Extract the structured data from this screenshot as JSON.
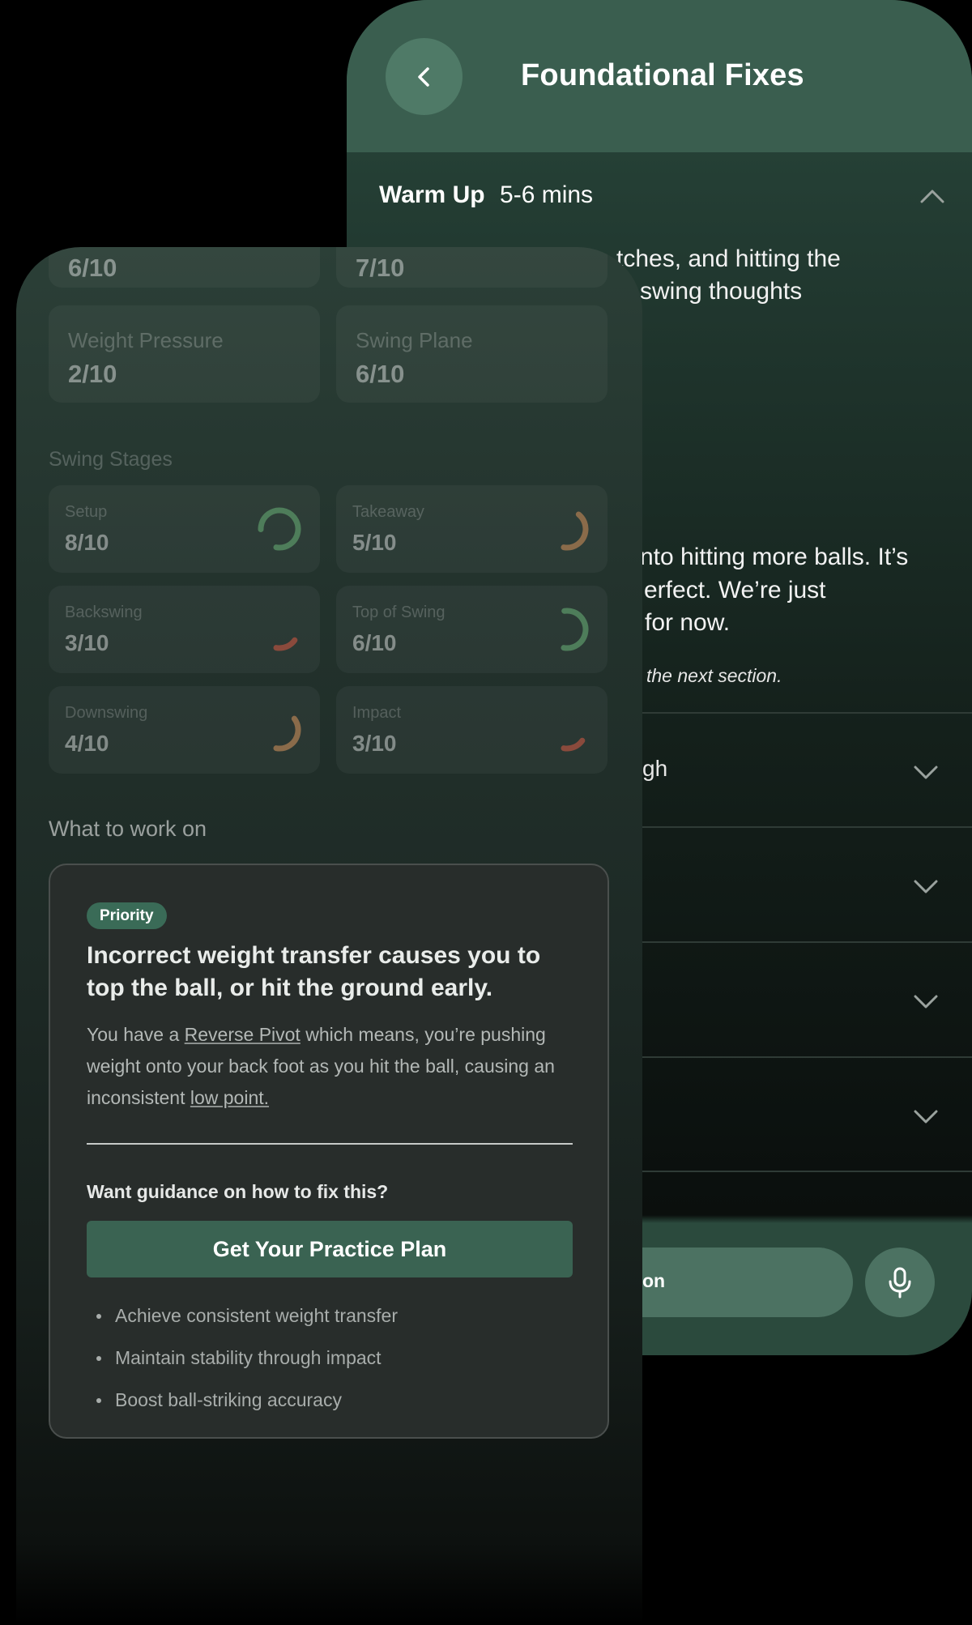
{
  "fixes_screen": {
    "title": "Foundational Fixes",
    "back_icon": "chevron-left-icon",
    "warm_up": {
      "title": "Warm Up",
      "duration": "5-6 mins",
      "line1": "tches, and hitting the",
      "line2": "swing thoughts",
      "line3": "nto hitting more balls. It’s",
      "line4": "erfect. We’re just",
      "line5": "for now.",
      "note": "the next section."
    },
    "sections": [
      {
        "label": "gh"
      },
      {
        "label": ""
      },
      {
        "label": ""
      },
      {
        "label": ""
      }
    ],
    "input_text": "on",
    "mic_icon": "microphone-icon"
  },
  "report_screen": {
    "top_scores": [
      {
        "title": "",
        "score": "6/10"
      },
      {
        "title": "",
        "score": "7/10"
      }
    ],
    "metrics": [
      {
        "title": "Weight Pressure",
        "score": "2/10"
      },
      {
        "title": "Swing Plane",
        "score": "6/10"
      }
    ],
    "stages_heading": "Swing Stages",
    "stages": [
      {
        "title": "Setup",
        "score": "8/10",
        "color": "#4e7d5a"
      },
      {
        "title": "Takeaway",
        "score": "5/10",
        "color": "#8a6b4a"
      },
      {
        "title": "Backswing",
        "score": "3/10",
        "color": "#8a4a3c"
      },
      {
        "title": "Top of Swing",
        "score": "6/10",
        "color": "#4e7d5a"
      },
      {
        "title": "Downswing",
        "score": "4/10",
        "color": "#8a6b4a"
      },
      {
        "title": "Impact",
        "score": "3/10",
        "color": "#8a4a3c"
      }
    ],
    "work_heading": "What to work on",
    "work": {
      "badge": "Priority",
      "title": "Incorrect weight transfer causes you to top the ball, or hit the ground early.",
      "desc_1": "You have a ",
      "desc_link1": "Reverse Pivot",
      "desc_2": " which means, you’re pushing weight onto your back foot as you hit the ball, causing an inconsistent ",
      "desc_link2": "low point.",
      "question": "Want guidance on how to fix this?",
      "cta": "Get Your Practice Plan",
      "benefits": [
        "Achieve consistent weight transfer",
        "Maintain stability through impact",
        "Boost ball-striking accuracy"
      ]
    }
  }
}
